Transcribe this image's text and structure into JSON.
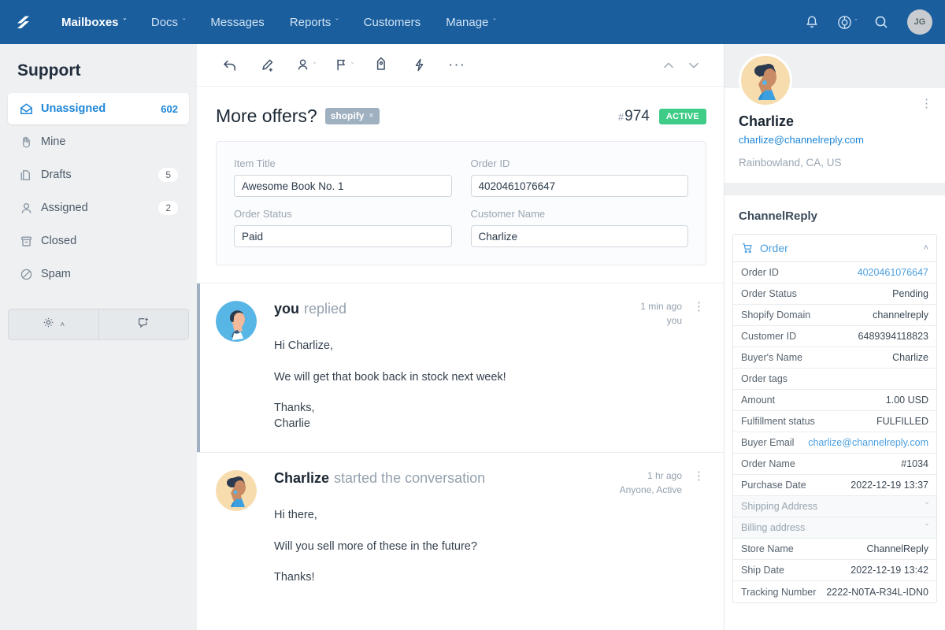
{
  "topnav": {
    "logo": "helpscout-logo-icon",
    "items": [
      {
        "label": "Mailboxes",
        "caret": "ˇ",
        "strong": true
      },
      {
        "label": "Docs",
        "caret": "ˇ",
        "strong": false
      },
      {
        "label": "Messages",
        "caret": "",
        "strong": false
      },
      {
        "label": "Reports",
        "caret": "ˇ",
        "strong": false
      },
      {
        "label": "Customers",
        "caret": "",
        "strong": false
      },
      {
        "label": "Manage",
        "caret": "ˇ",
        "strong": false
      }
    ],
    "icons": {
      "notifications": "bell-icon",
      "help": "lifebuoy-icon",
      "help_caret": "ˇ",
      "search": "search-icon"
    },
    "avatar_initials": "JG"
  },
  "sidebar": {
    "title": "Support",
    "items": [
      {
        "label": "Unassigned",
        "count": "602",
        "icon": "open-envelope-icon",
        "active": true
      },
      {
        "label": "Mine",
        "count": "",
        "icon": "hand-icon",
        "active": false
      },
      {
        "label": "Drafts",
        "count": "5",
        "icon": "drafts-icon",
        "active": false
      },
      {
        "label": "Assigned",
        "count": "2",
        "icon": "person-icon",
        "active": false
      },
      {
        "label": "Closed",
        "count": "",
        "icon": "archive-icon",
        "active": false
      },
      {
        "label": "Spam",
        "count": "",
        "icon": "block-icon",
        "active": false
      }
    ],
    "actions": {
      "settings": "gear-icon",
      "settings_caret": "˄",
      "new_conversation": "new-conversation-icon"
    }
  },
  "toolbar": {
    "buttons": [
      {
        "name": "reply-icon",
        "caret": ""
      },
      {
        "name": "add-note-icon",
        "caret": ""
      },
      {
        "name": "assign-person-icon",
        "caret": "ˇ"
      },
      {
        "name": "status-flag-icon",
        "caret": "ˇ"
      },
      {
        "name": "tag-icon",
        "caret": ""
      },
      {
        "name": "workflow-lightning-icon",
        "caret": ""
      },
      {
        "name": "more-options-icon",
        "caret": ""
      }
    ],
    "more_glyph": "···",
    "prev": "chevron-up-icon",
    "next": "chevron-down-icon"
  },
  "conversation": {
    "title": "More offers?",
    "tag": {
      "label": "shopify",
      "remove": "×"
    },
    "number_hash": "#",
    "number": "974",
    "status_badge": "ACTIVE"
  },
  "order_form": {
    "fields": [
      {
        "label": "Item Title",
        "value": "Awesome Book No. 1"
      },
      {
        "label": "Order ID",
        "value": "4020461076647"
      },
      {
        "label": "Order Status",
        "value": "Paid"
      },
      {
        "label": "Customer Name",
        "value": "Charlize"
      }
    ]
  },
  "thread": [
    {
      "author": "you",
      "action": "replied",
      "time": "1 min ago",
      "sub": "you",
      "kebab": "⋮",
      "avatar": "agent-avatar",
      "lines": [
        "Hi Charlize,",
        "We will get that book back in stock next week!",
        "Thanks,",
        "Charlie"
      ]
    },
    {
      "author": "Charlize",
      "action": "started the conversation",
      "time": "1 hr ago",
      "sub": "Anyone, Active",
      "kebab": "⋮",
      "avatar": "customer-avatar",
      "lines": [
        "Hi there,",
        "Will you sell more of these in the future?",
        "Thanks!"
      ]
    }
  ],
  "customer": {
    "name": "Charlize",
    "email": "charlize@channelreply.com",
    "location": "Rainbowland, CA, US",
    "kebab": "⋮"
  },
  "channelreply": {
    "title": "ChannelReply",
    "order_section": {
      "label": "Order",
      "icon": "shopping-cart-icon",
      "chevron": "˄"
    },
    "rows": [
      {
        "key": "Order ID",
        "value": "4020461076647",
        "link": true
      },
      {
        "key": "Order Status",
        "value": "Pending",
        "link": false
      },
      {
        "key": "Shopify Domain",
        "value": "channelreply",
        "link": false
      },
      {
        "key": "Customer ID",
        "value": "6489394118823",
        "link": false
      },
      {
        "key": "Buyer's Name",
        "value": "Charlize",
        "link": false
      },
      {
        "key": "Order tags",
        "value": "",
        "link": false
      },
      {
        "key": "Amount",
        "value": "1.00 USD",
        "link": false
      },
      {
        "key": "Fulfillment status",
        "value": "FULFILLED",
        "link": false
      },
      {
        "key": "Buyer Email",
        "value": "charlize@channelreply.com",
        "link": true
      },
      {
        "key": "Order Name",
        "value": "#1034",
        "link": false
      },
      {
        "key": "Purchase Date",
        "value": "2022-12-19 13:37",
        "link": false
      },
      {
        "key": "Shipping Address",
        "value": "",
        "link": false,
        "collapsible": true,
        "chevron": "ˇ"
      },
      {
        "key": "Billing address",
        "value": "",
        "link": false,
        "collapsible": true,
        "chevron": "ˇ"
      },
      {
        "key": "Store Name",
        "value": "ChannelReply",
        "link": false
      },
      {
        "key": "Ship Date",
        "value": "2022-12-19 13:42",
        "link": false
      },
      {
        "key": "Tracking Number",
        "value": "2222-N0TA-R34L-IDN0",
        "link": false
      }
    ]
  },
  "colors": {
    "nav": "#1b5e9e",
    "accent": "#1e86d8",
    "status_green": "#3fcc86",
    "tag_grey": "#9fb0c0"
  }
}
